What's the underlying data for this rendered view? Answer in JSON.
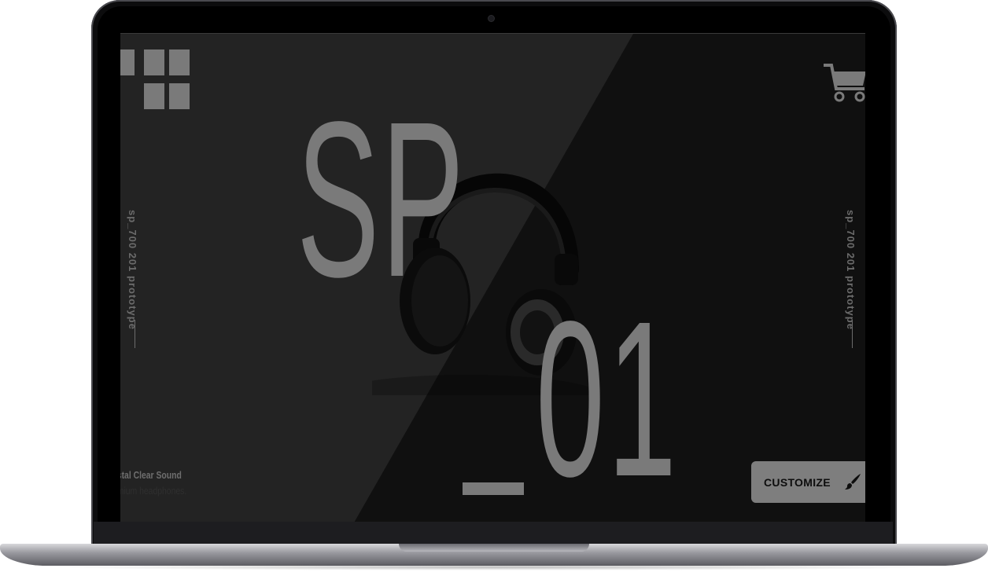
{
  "screen": {
    "big_title_top": "SP",
    "big_title_bottom": "01",
    "side_text_left": "sp_700 201 prototype",
    "side_text_right": "sp_700 201 prototype",
    "tagline_line1": "ystal Clear Sound",
    "tagline_line2": "emium headphones.",
    "customize_label": "CUSTOMIZE"
  },
  "icons": {
    "menu": "grid-menu-icon",
    "cart": "shopping-cart-icon",
    "customize": "paint-brush-icon"
  },
  "colors": {
    "accent_gray": "#7a7a7a",
    "panel_dark": "#232323",
    "panel_darker": "#101010"
  }
}
